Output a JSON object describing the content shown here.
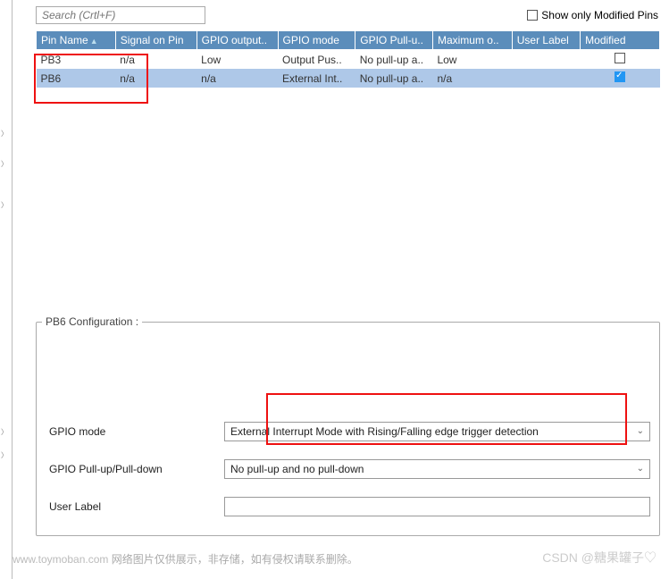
{
  "top": {
    "search_placeholder": "Search (Crtl+F)",
    "show_modified_label": "Show only Modified Pins"
  },
  "table": {
    "headers": [
      "Pin Name",
      "Signal on Pin",
      "GPIO output..",
      "GPIO mode",
      "GPIO Pull-u..",
      "Maximum o..",
      "User Label",
      "Modified"
    ],
    "rows": [
      {
        "pin": "PB3",
        "signal": "n/a",
        "out": "Low",
        "mode": "Output Pus..",
        "pull": "No pull-up a..",
        "max": "Low",
        "label": "",
        "modified": false,
        "selected": false
      },
      {
        "pin": "PB6",
        "signal": "n/a",
        "out": "n/a",
        "mode": "External Int..",
        "pull": "No pull-up a..",
        "max": "n/a",
        "label": "",
        "modified": true,
        "selected": true
      }
    ]
  },
  "config": {
    "title": "PB6 Configuration :",
    "rows": [
      {
        "label": "GPIO mode",
        "value": "External Interrupt Mode with Rising/Falling edge trigger detection",
        "type": "select"
      },
      {
        "label": "GPIO Pull-up/Pull-down",
        "value": "No pull-up and no pull-down",
        "type": "select"
      },
      {
        "label": "User Label",
        "value": "",
        "type": "input"
      }
    ]
  },
  "footer": {
    "left_prefix": "www.toymoban.com",
    "left_rest": " 网络图片仅供展示，非存储，如有侵权请联系删除。",
    "right": "CSDN @糖果罐子♡"
  }
}
